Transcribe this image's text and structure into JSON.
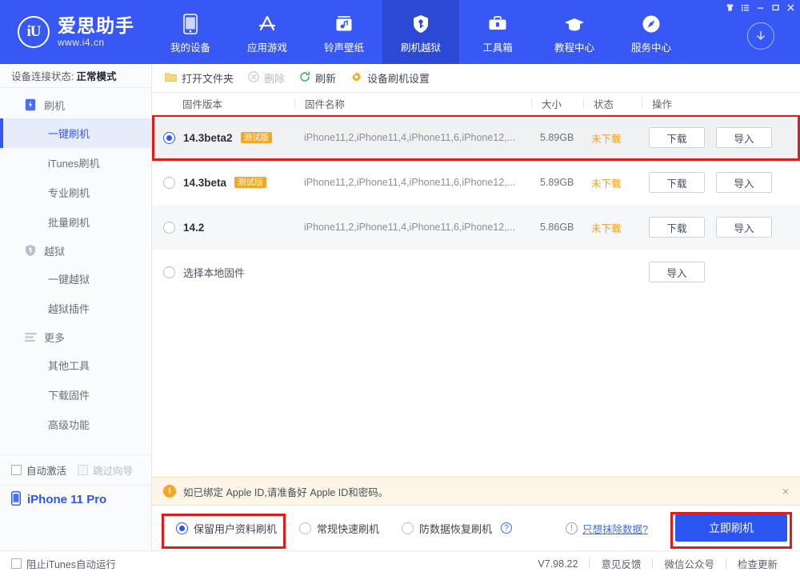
{
  "header": {
    "brand_mark": "iU",
    "brand_name": "爱思助手",
    "brand_url": "www.i4.cn",
    "nav": [
      {
        "label": "我的设备",
        "icon": "phone-icon",
        "active": false
      },
      {
        "label": "应用游戏",
        "icon": "appstore-icon",
        "active": false
      },
      {
        "label": "铃声壁纸",
        "icon": "music-box-icon",
        "active": false
      },
      {
        "label": "刷机越狱",
        "icon": "shield-key-icon",
        "active": true
      },
      {
        "label": "工具箱",
        "icon": "toolbox-icon",
        "active": false
      },
      {
        "label": "教程中心",
        "icon": "graduation-cap-icon",
        "active": false
      },
      {
        "label": "服务中心",
        "icon": "compass-icon",
        "active": false
      }
    ],
    "window_buttons": [
      "shirt-icon",
      "list-icon",
      "minimize-icon",
      "maximize-icon",
      "close-icon"
    ],
    "download_button": "download-arrow-icon",
    "accent_color": "#3858f6",
    "active_tab_color": "#2c49d6"
  },
  "sidebar": {
    "connection_label": "设备连接状态:",
    "connection_value": "正常模式",
    "groups": [
      {
        "label": "刷机",
        "icon": "flash-device-icon",
        "items": [
          {
            "label": "一键刷机",
            "active": true
          },
          {
            "label": "iTunes刷机",
            "active": false
          },
          {
            "label": "专业刷机",
            "active": false
          },
          {
            "label": "批量刷机",
            "active": false
          }
        ]
      },
      {
        "label": "越狱",
        "icon": "shield-jailbreak-icon",
        "items": [
          {
            "label": "一键越狱",
            "active": false
          },
          {
            "label": "越狱插件",
            "active": false
          }
        ]
      },
      {
        "label": "更多",
        "icon": "more-lines-icon",
        "items": [
          {
            "label": "其他工具",
            "active": false
          },
          {
            "label": "下载固件",
            "active": false
          },
          {
            "label": "高级功能",
            "active": false
          }
        ]
      }
    ],
    "checkboxes": [
      {
        "label": "自动激活",
        "checked": false,
        "disabled": false
      },
      {
        "label": "跳过向导",
        "checked": false,
        "disabled": true
      }
    ],
    "device": {
      "name": "iPhone 11 Pro",
      "icon": "phone-small-icon"
    }
  },
  "toolbar": {
    "buttons": [
      {
        "label": "打开文件夹",
        "icon": "folder-icon",
        "disabled": false
      },
      {
        "label": "删除",
        "icon": "delete-circle-icon",
        "disabled": true
      },
      {
        "label": "刷新",
        "icon": "refresh-icon",
        "disabled": false
      },
      {
        "label": "设备刷机设置",
        "icon": "gear-icon",
        "disabled": false
      }
    ]
  },
  "table": {
    "columns": [
      "固件版本",
      "固件名称",
      "大小",
      "状态",
      "操作"
    ],
    "rows": [
      {
        "version": "14.3beta2",
        "tag": "测试版",
        "name": "iPhone11,2,iPhone11,4,iPhone11,6,iPhone12,...",
        "size": "5.89GB",
        "status": "未下载",
        "actions": [
          "下载",
          "导入"
        ],
        "selected": true
      },
      {
        "version": "14.3beta",
        "tag": "测试版",
        "name": "iPhone11,2,iPhone11,4,iPhone11,6,iPhone12,...",
        "size": "5.89GB",
        "status": "未下载",
        "actions": [
          "下载",
          "导入"
        ],
        "selected": false
      },
      {
        "version": "14.2",
        "tag": "",
        "name": "iPhone11,2,iPhone11,4,iPhone11,6,iPhone12,...",
        "size": "5.86GB",
        "status": "未下载",
        "actions": [
          "下载",
          "导入"
        ],
        "selected": false
      }
    ],
    "local_row": {
      "label": "选择本地固件",
      "action": "导入",
      "selected": false
    }
  },
  "notice": {
    "icon": "warning-icon",
    "text": "如已绑定 Apple ID,请准备好 Apple ID和密码。",
    "close": "×"
  },
  "actionbar": {
    "modes": [
      {
        "label": "保留用户资料刷机",
        "selected": true,
        "help": false
      },
      {
        "label": "常规快速刷机",
        "selected": false,
        "help": false
      },
      {
        "label": "防数据恢复刷机",
        "selected": false,
        "help": true
      }
    ],
    "erase_link": "只想抹除数据?",
    "primary_button": "立即刷机",
    "primary_color": "#2a55f0"
  },
  "statusbar": {
    "checkbox_label": "阻止iTunes自动运行",
    "checkbox_checked": false,
    "version": "V7.98.22",
    "links": [
      "意见反馈",
      "微信公众号",
      "检查更新"
    ]
  },
  "highlights": {
    "color": "#e01b1b",
    "regions": [
      "firmware-row-0",
      "keep-data-mode",
      "flash-now-button"
    ]
  }
}
